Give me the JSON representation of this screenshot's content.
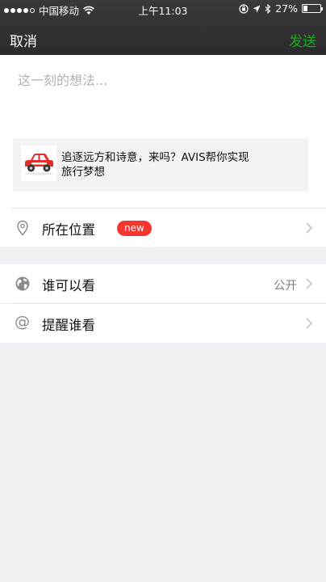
{
  "status_bar": {
    "carrier": "中国移动",
    "time": "上午11:03",
    "battery": "27%",
    "battery_level": 0.27
  },
  "nav": {
    "cancel": "取消",
    "send": "发送"
  },
  "compose": {
    "placeholder": "这一刻的想法...",
    "share_card_line1": "追逐远方和诗意，来吗？AVIS帮你实现",
    "share_card_line2": "旅行梦想"
  },
  "location": {
    "label": "所在位置",
    "badge": "new"
  },
  "visibility": {
    "label": "谁可以看",
    "value": "公开"
  },
  "mention": {
    "label": "提醒谁看"
  },
  "colors": {
    "send": "#1aad19",
    "badge": "#f43530",
    "car": "#e0302c"
  }
}
